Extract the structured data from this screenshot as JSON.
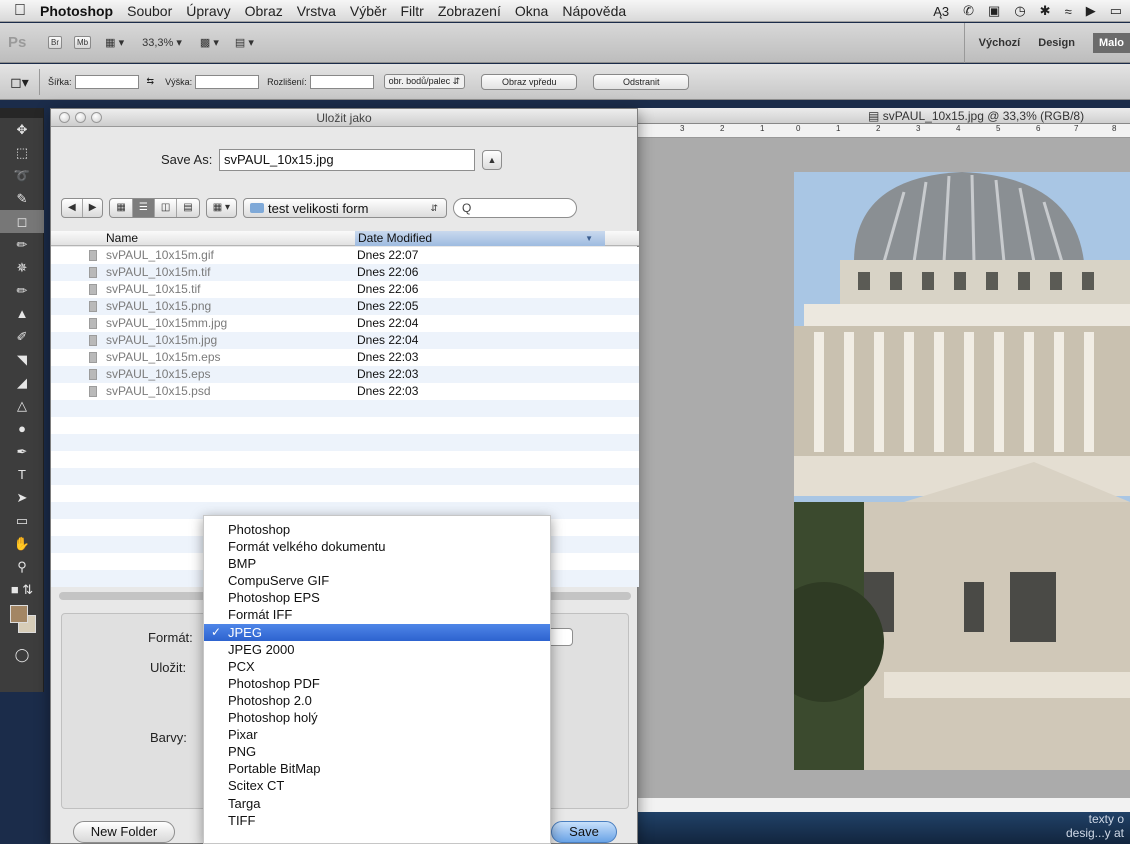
{
  "menubar": {
    "app": "Photoshop",
    "items": [
      "Soubor",
      "Úpravy",
      "Obraz",
      "Vrstva",
      "Výběr",
      "Filtr",
      "Zobrazení",
      "Okna",
      "Nápověda"
    ],
    "status_text": "3"
  },
  "appbar": {
    "logo": "Ps",
    "bridge": "Br",
    "minibridge": "Mb",
    "zoom": "33,3%",
    "workspaces": [
      "Výchozí",
      "Design",
      "Malo"
    ]
  },
  "options": {
    "width_label": "Šířka:",
    "height_label": "Výška:",
    "resolution_label": "Rozlišení:",
    "unit_select": "obr. bodů/palec",
    "front_image_button": "Obraz vpředu",
    "clear_button": "Odstranit"
  },
  "document": {
    "title": "svPAUL_10x15.jpg @ 33,3% (RGB/8)",
    "ruler_ticks": [
      "3",
      "2",
      "1",
      "0",
      "1",
      "2",
      "3",
      "4",
      "5",
      "6",
      "7",
      "8"
    ]
  },
  "dialog": {
    "title": "Uložit jako",
    "save_as_label": "Save As:",
    "filename": "svPAUL_10x15.jpg",
    "folder": "test velikosti form",
    "search_placeholder": "Q",
    "col_name": "Name",
    "col_date": "Date Modified",
    "files": [
      {
        "name": "svPAUL_10x15m.gif",
        "date": "Dnes 22:07"
      },
      {
        "name": "svPAUL_10x15m.tif",
        "date": "Dnes 22:06"
      },
      {
        "name": "svPAUL_10x15.tif",
        "date": "Dnes 22:06"
      },
      {
        "name": "svPAUL_10x15.png",
        "date": "Dnes 22:05"
      },
      {
        "name": "svPAUL_10x15mm.jpg",
        "date": "Dnes 22:04"
      },
      {
        "name": "svPAUL_10x15m.jpg",
        "date": "Dnes 22:04"
      },
      {
        "name": "svPAUL_10x15m.eps",
        "date": "Dnes 22:03"
      },
      {
        "name": "svPAUL_10x15.eps",
        "date": "Dnes 22:03"
      },
      {
        "name": "svPAUL_10x15.psd",
        "date": "Dnes 22:03"
      }
    ],
    "format_label": "Formát:",
    "save_label": "Uložit:",
    "colors_label": "Barvy:",
    "new_folder_button": "New Folder",
    "save_button": "Save"
  },
  "format_menu": {
    "selected": "JPEG",
    "options": [
      "Photoshop",
      "Formát velkého dokumentu",
      "BMP",
      "CompuServe GIF",
      "Photoshop EPS",
      "Formát IFF",
      "JPEG",
      "JPEG 2000",
      "PCX",
      "Photoshop PDF",
      "Photoshop 2.0",
      "Photoshop holý",
      "Pixar",
      "PNG",
      "Portable BitMap",
      "Scitex CT",
      "Targa",
      "TIFF"
    ]
  },
  "desktop": {
    "line1": "texty o",
    "line2": "desig...y at"
  },
  "colors": {
    "menu_highlight": "#3b72dc",
    "date_header": "#b3cbe9",
    "foreground_swatch": "#a38664"
  }
}
